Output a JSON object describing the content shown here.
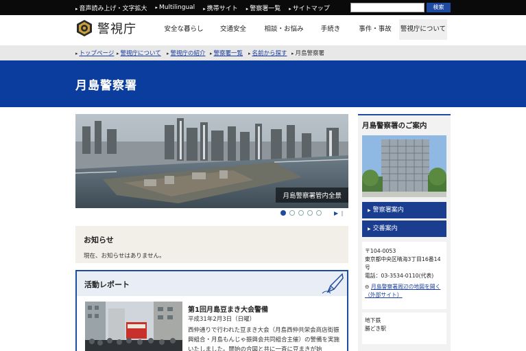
{
  "topbar": {
    "links": [
      "音声読み上げ・文字拡大",
      "Multilingual",
      "携帯サイト",
      "警察署一覧",
      "サイトマップ"
    ],
    "search_value": "",
    "search_button": "検索"
  },
  "header": {
    "logo_text": "警視庁",
    "nav": [
      "安全な暮らし",
      "交通安全",
      "相談・お悩み",
      "手続き",
      "事件・事故",
      "警視庁について"
    ]
  },
  "breadcrumb": {
    "items": [
      "トップページ",
      "警視庁について",
      "警視庁の紹介",
      "警察署一覧",
      "名前から探す"
    ],
    "current": "月島警察署"
  },
  "page": {
    "title": "月島警察署"
  },
  "hero": {
    "caption": "月島警察署管内全景",
    "slide_count": 5,
    "active_index": 0
  },
  "news": {
    "title": "お知らせ",
    "body": "現在、お知らせはありません。"
  },
  "activity": {
    "title": "活動レポート",
    "item_title": "第1回月島豆まき大会警備",
    "item_date": "平成31年2月3日（日曜）",
    "item_body": "西仲通りで行われた豆まき大会（月島西仲共栄会商店街振興組合・月島もんじゃ振興会共同組合主催）の警備を実施いたしました。開始の合図と共に一斉に豆まきが始"
  },
  "sidebar": {
    "title": "月島警察署のご案内",
    "buttons": [
      "警察署案内",
      "交番案内"
    ],
    "postal": "〒104-0053",
    "address": "東京都中央区晴海3丁目16番14号",
    "phone": "電話：03-3534-0110(代表)",
    "map_link": "月島警察署周辺の地図を開く（外部サイト）",
    "access_line1": "地下鉄",
    "access_line2": "勝どき駅"
  },
  "colors": {
    "primary": "#0b3d9e",
    "link": "#1a3d9c",
    "dark": "#0a0a0a"
  }
}
